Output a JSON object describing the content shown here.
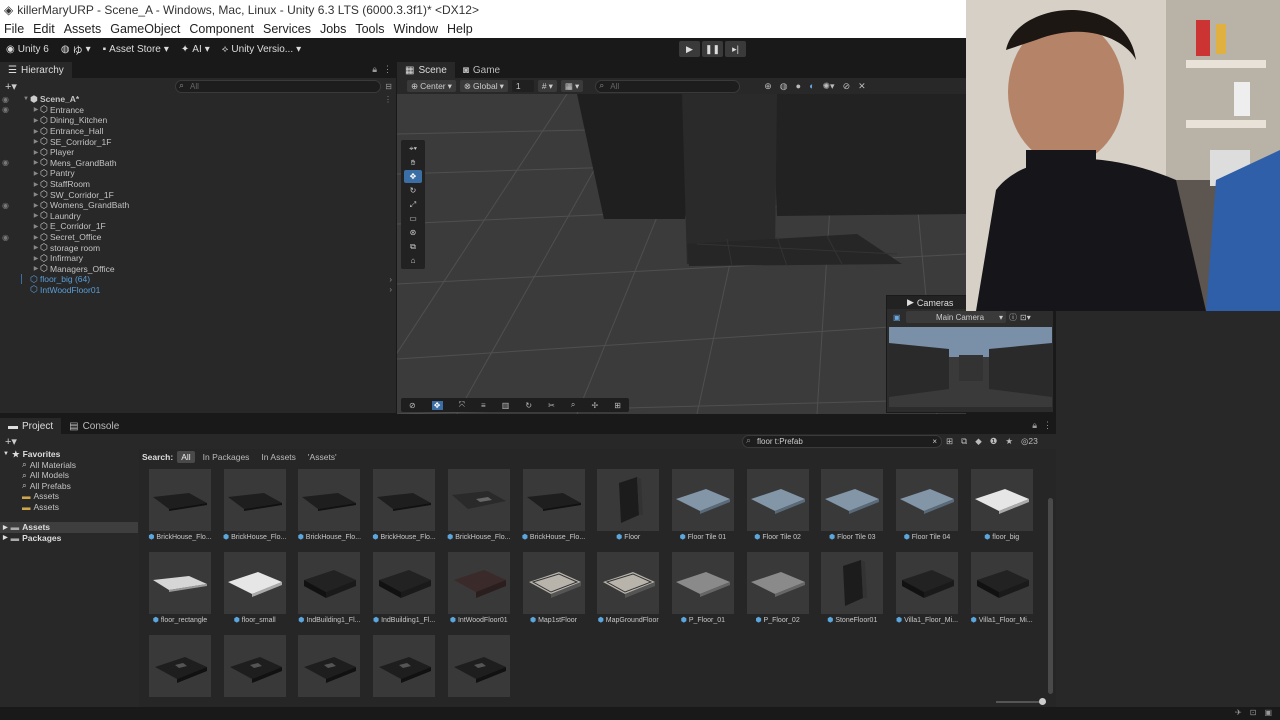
{
  "window": {
    "title": "killerMaryURP - Scene_A - Windows, Mac, Linux - Unity 6.3 LTS (6000.3.3f1)* <DX12>"
  },
  "menu": [
    "File",
    "Edit",
    "Assets",
    "GameObject",
    "Component",
    "Services",
    "Jobs",
    "Tools",
    "Window",
    "Help"
  ],
  "toolbar": {
    "unity": "Unity 6",
    "account": "ゆ",
    "asset_store": "Asset Store",
    "ai": "AI",
    "version": "Unity Versio..."
  },
  "hierarchy": {
    "tab": "Hierarchy",
    "search_placeholder": "All",
    "scene": "Scene_A*",
    "items": [
      {
        "label": "Entrance",
        "eye": true
      },
      {
        "label": "Dining_Kitchen",
        "eye": false
      },
      {
        "label": "Entrance_Hall",
        "eye": false
      },
      {
        "label": "SE_Corridor_1F",
        "eye": false
      },
      {
        "label": "Player",
        "eye": false
      },
      {
        "label": "Mens_GrandBath",
        "eye": true
      },
      {
        "label": "Pantry",
        "eye": false
      },
      {
        "label": "StaffRoom",
        "eye": false
      },
      {
        "label": "SW_Corridor_1F",
        "eye": false
      },
      {
        "label": "Womens_GrandBath",
        "eye": true
      },
      {
        "label": "Laundry",
        "eye": false
      },
      {
        "label": "E_Corridor_1F",
        "eye": false
      },
      {
        "label": "Secret_Office",
        "eye": true
      },
      {
        "label": "storage room",
        "eye": false
      },
      {
        "label": "Infirmary",
        "eye": false
      },
      {
        "label": "Managers_Office",
        "eye": false
      }
    ],
    "prefab_items": [
      "floor_big (64)",
      "IntWoodFloor01"
    ]
  },
  "scene": {
    "tabs": [
      "Scene",
      "Game"
    ],
    "pivot": "Center",
    "space": "Global",
    "grid_size": "1",
    "search_placeholder": "All"
  },
  "cameras": {
    "title": "Cameras",
    "selected": "Main Camera"
  },
  "project": {
    "tabs": [
      "Project",
      "Console"
    ],
    "search_value": "floor t:Prefab",
    "count": "23",
    "search_label": "Search:",
    "scopes": [
      "All",
      "In Packages",
      "In Assets",
      "'Assets'"
    ],
    "favorites": {
      "label": "Favorites",
      "items": [
        "All Materials",
        "All Models",
        "All Prefabs",
        "Assets",
        "Assets"
      ]
    },
    "roots": [
      "Assets",
      "Packages"
    ],
    "assets": [
      "BrickHouse_Flo...",
      "BrickHouse_Flo...",
      "BrickHouse_Flo...",
      "BrickHouse_Flo...",
      "BrickHouse_Flo...",
      "BrickHouse_Flo...",
      "Floor",
      "Floor Tile 01",
      "Floor Tile 02",
      "Floor Tile 03",
      "Floor Tile 04",
      "floor_big",
      "floor_rectangle",
      "floor_small",
      "IndBuilding1_Fl...",
      "IndBuilding1_Fl...",
      "IntWoodFloor01",
      "Map1stFloor",
      "MapGroundFloor",
      "P_Floor_01",
      "P_Floor_02",
      "StoneFloor01",
      "Villa1_Floor_Mi...",
      "Villa1_Floor_Mi...",
      "",
      "",
      "",
      "",
      ""
    ]
  }
}
